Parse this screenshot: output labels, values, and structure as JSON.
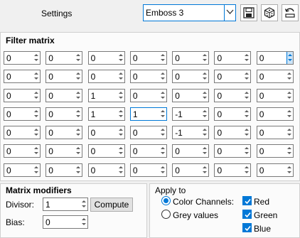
{
  "header": {
    "settings_label": "Settings",
    "preset_value": "Emboss 3",
    "save_icon": "save-icon",
    "random_icon": "dice-icon",
    "reset_icon": "reset-icon"
  },
  "filter_matrix": {
    "title": "Filter matrix",
    "cells": [
      [
        "0",
        "0",
        "0",
        "0",
        "0",
        "0",
        "0"
      ],
      [
        "0",
        "0",
        "0",
        "0",
        "0",
        "0",
        "0"
      ],
      [
        "0",
        "0",
        "1",
        "0",
        "0",
        "0",
        "0"
      ],
      [
        "0",
        "0",
        "1",
        "1",
        "-1",
        "0",
        "0"
      ],
      [
        "0",
        "0",
        "0",
        "0",
        "-1",
        "0",
        "0"
      ],
      [
        "0",
        "0",
        "0",
        "0",
        "0",
        "0",
        "0"
      ],
      [
        "0",
        "0",
        "0",
        "0",
        "0",
        "0",
        "0"
      ]
    ]
  },
  "modifiers": {
    "title": "Matrix modifiers",
    "divisor_label": "Divisor:",
    "divisor_value": "1",
    "compute_label": "Compute",
    "bias_label": "Bias:",
    "bias_value": "0"
  },
  "apply_to": {
    "title": "Apply to",
    "color_channels_label": "Color Channels:",
    "color_channels_checked": true,
    "grey_values_label": "Grey values",
    "grey_values_checked": false,
    "red_label": "Red",
    "green_label": "Green",
    "blue_label": "Blue"
  },
  "colors": {
    "accent": "#0078d7",
    "panel_bg": "#fbfbfb",
    "window_bg": "#f0f0f0"
  }
}
